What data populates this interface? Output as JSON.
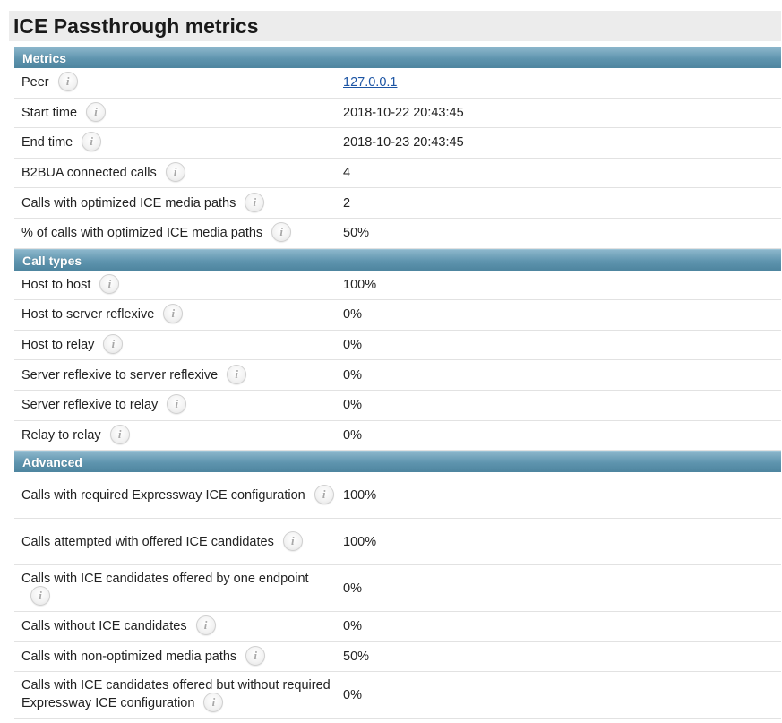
{
  "page": {
    "title": "ICE Passthrough metrics",
    "info_glyph": "i"
  },
  "metrics": {
    "header": "Metrics",
    "rows": [
      {
        "label": "Peer",
        "value": "127.0.0.1"
      },
      {
        "label": "Start time",
        "value": "2018-10-22 20:43:45"
      },
      {
        "label": "End time",
        "value": "2018-10-23 20:43:45"
      },
      {
        "label": "B2BUA connected calls",
        "value": "4"
      },
      {
        "label": "Calls with optimized ICE media paths",
        "value": "2"
      },
      {
        "label": "% of calls with optimized ICE media paths",
        "value": "50%"
      }
    ]
  },
  "call_types": {
    "header": "Call types",
    "rows": [
      {
        "label": "Host to host",
        "value": "100%"
      },
      {
        "label": "Host to server reflexive",
        "value": "0%"
      },
      {
        "label": "Host to relay",
        "value": "0%"
      },
      {
        "label": "Server reflexive to server reflexive",
        "value": "0%"
      },
      {
        "label": "Server reflexive to relay",
        "value": "0%"
      },
      {
        "label": "Relay to relay",
        "value": "0%"
      }
    ]
  },
  "advanced": {
    "header": "Advanced",
    "rows": [
      {
        "label": "Calls with required Expressway ICE configuration",
        "value": "100%"
      },
      {
        "label": "Calls attempted with offered ICE candidates",
        "value": "100%"
      },
      {
        "label": "Calls with ICE candidates offered by one endpoint",
        "value": "0%"
      },
      {
        "label": "Calls without ICE candidates",
        "value": "0%"
      },
      {
        "label": "Calls with non-optimized media paths",
        "value": "50%"
      },
      {
        "label": "Calls with ICE candidates offered but without required Expressway ICE configuration",
        "value": "0%"
      }
    ]
  },
  "colors": {
    "section_header": "#5e94ae",
    "link": "#1d55a4"
  },
  "icons": {
    "info": "info-icon"
  }
}
